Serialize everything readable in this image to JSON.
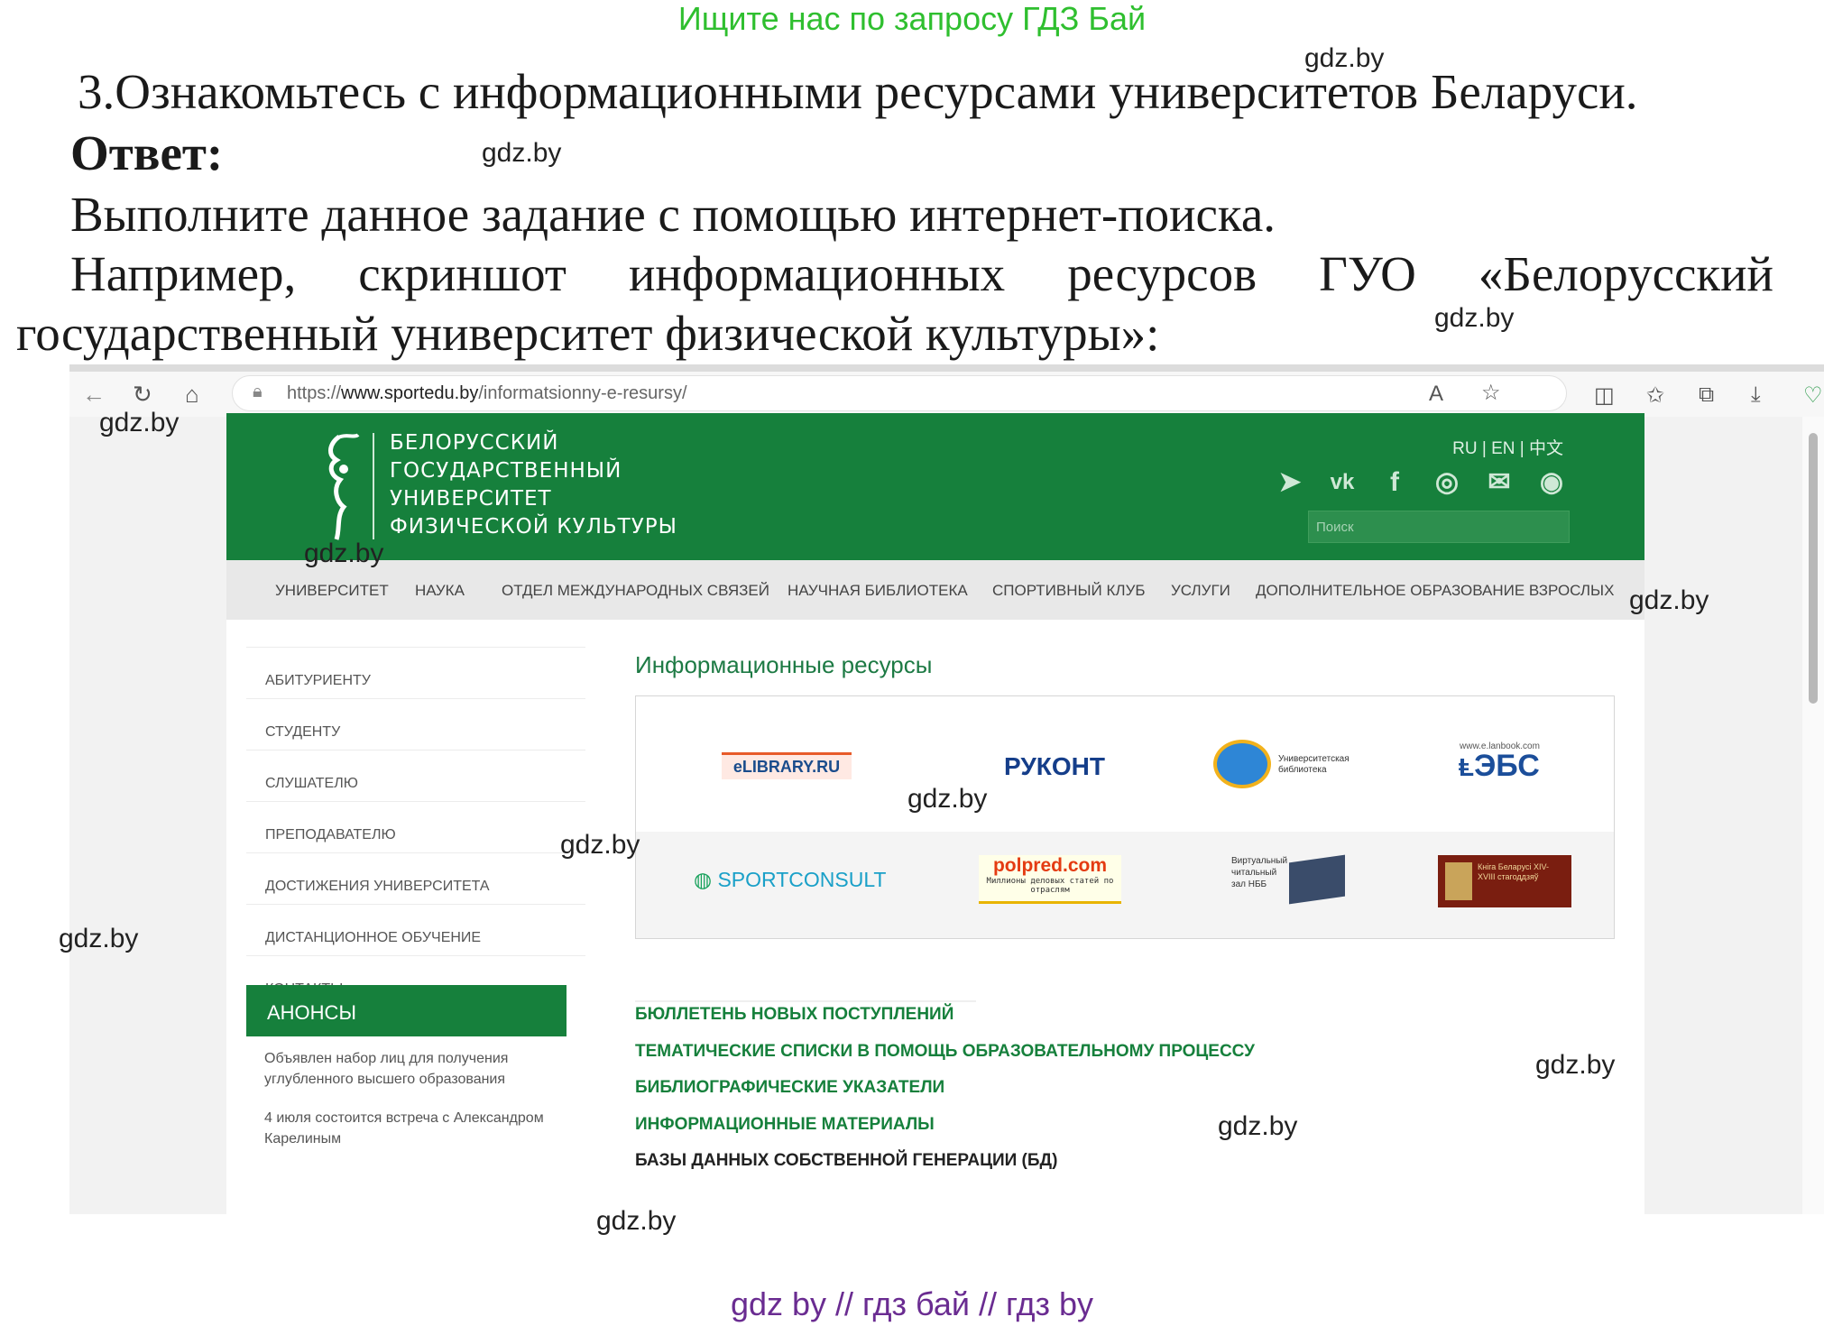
{
  "banner": "Ищите нас по запросу ГДЗ Бай",
  "watermark": "gdz.by",
  "task": {
    "title": "3.Ознакомьтесь с информационными ресурсами университетов Беларуси.",
    "answer_label": "Ответ:",
    "line1": "Выполните данное задание с помощью интернет-поиска.",
    "line2_words": [
      "Например,",
      "скриншот",
      "информационных",
      "ресурсов",
      "ГУО",
      "«Белорусский"
    ],
    "line3": "государственный университет физической культуры»:"
  },
  "browser": {
    "url_prefix": "https://",
    "url_domain": "www.sportedu.by",
    "url_path": "/informatsionny-e-resursy/"
  },
  "site": {
    "name_lines": [
      "БЕЛОРУССКИЙ",
      "ГОСУДАРСТВЕННЫЙ",
      "УНИВЕРСИТЕТ",
      "ФИЗИЧЕСКОЙ КУЛЬТУРЫ"
    ],
    "langs": "RU | EN | 中文",
    "search_placeholder": "Поиск",
    "menu": [
      "УНИВЕРСИТЕТ",
      "НАУКА",
      "ОТДЕЛ МЕЖДУНАРОДНЫХ СВЯЗЕЙ",
      "НАУЧНАЯ БИБЛИОТЕКА",
      "СПОРТИВНЫЙ КЛУБ",
      "УСЛУГИ",
      "ДОПОЛНИТЕЛЬНОЕ ОБРАЗОВАНИЕ ВЗРОСЛЫХ"
    ],
    "side": [
      "АБИТУРИЕНТУ",
      "СТУДЕНТУ",
      "СЛУШАТЕЛЮ",
      "ПРЕПОДАВАТЕЛЮ",
      "ДОСТИЖЕНИЯ УНИВЕРСИТЕТА",
      "ДИСТАНЦИОННОЕ ОБУЧЕНИЕ",
      "КОНТАКТЫ"
    ],
    "announce_title": "АНОНСЫ",
    "announcements": [
      "Объявлен набор лиц для получения углубленного высшего образования",
      "4 июля состоится встреча с Александром Карелиным"
    ],
    "content_title": "Информационные ресурсы",
    "logos": {
      "elibrary": "eLIBRARY.RU",
      "rukont": "РУКОНТ",
      "unibib": "Университетская библиотека",
      "lanbook_url": "www.e.lanbook.com",
      "ebs": "ЭБС",
      "sportconsult": "SPORTCONSULT",
      "polpred": "polpred.com",
      "polpred_sub": "Миллионы деловых статей по отраслям",
      "virtual": "Виртуальный читальный зал НББ",
      "kniga": "Кніга Беларусі XIV-XVIII стагоддзяў"
    },
    "links": [
      "БЮЛЛЕТЕНЬ НОВЫХ ПОСТУПЛЕНИЙ",
      "ТЕМАТИЧЕСКИЕ СПИСКИ В ПОМОЩЬ ОБРАЗОВАТЕЛЬНОМУ ПРОЦЕССУ",
      "БИБЛИОГРАФИЧЕСКИЕ УКАЗАТЕЛИ",
      "ИНФОРМАЦИОННЫЕ МАТЕРИАЛЫ",
      "БАЗЫ ДАННЫХ СОБСТВЕННОЙ ГЕНЕРАЦИИ (БД)"
    ]
  },
  "footer": "gdz by  //  гдз бай  //  гдз by",
  "colors": {
    "brand_green": "#16803c",
    "banner_green": "#2fbf2f",
    "footer_purple": "#6a2c91"
  }
}
